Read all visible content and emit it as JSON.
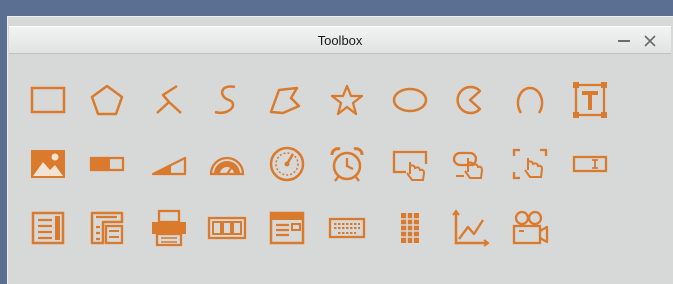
{
  "window": {
    "title": "Toolbox",
    "buttons": {
      "minimize": "minimize",
      "close": "close"
    }
  },
  "colors": {
    "icon": "#d97a2c",
    "background": "#d7d8d8",
    "desktop": "#5b6f92"
  },
  "tools": [
    [
      "rectangle-icon",
      "pentagon-icon",
      "polyline-icon",
      "curve-icon",
      "polygon-icon",
      "star-icon",
      "ellipse-icon",
      "pie-icon",
      "arc-icon",
      "text-icon"
    ],
    [
      "image-icon",
      "progress-bar-icon",
      "slider-icon",
      "gauge-icon",
      "dial-icon",
      "alarm-clock-icon",
      "touch-area-icon",
      "touch-button-icon",
      "touch-region-icon",
      "input-field-icon"
    ],
    [
      "document-icon",
      "list-box-icon",
      "printer-icon",
      "display-icon",
      "panel-icon",
      "keyboard-icon",
      "grid-icon",
      "line-chart-icon",
      "video-camera-icon"
    ]
  ]
}
